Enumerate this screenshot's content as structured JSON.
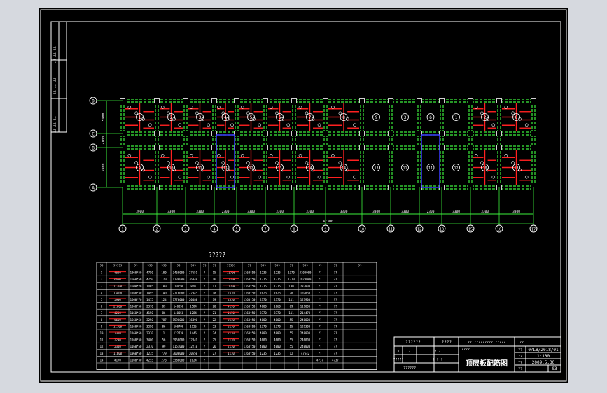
{
  "drawing": {
    "title": "顶层板配筋图",
    "table_title": "?????"
  },
  "axes": {
    "row_labels": [
      "D",
      "C",
      "B",
      "A"
    ],
    "column_labels": [
      "1",
      "2",
      "3",
      "4",
      "5",
      "7",
      "8",
      "9",
      "10",
      "11",
      "12",
      "13",
      "15",
      "16",
      "17"
    ],
    "bay_dims": [
      "3900",
      "3300",
      "3300",
      "2300",
      "3300",
      "3300",
      "3300",
      "3300",
      "3300",
      "3300",
      "2300",
      "3300",
      "3300",
      "3300"
    ],
    "overall_dim": "47300",
    "row_dims": [
      "5900",
      "2100",
      "5900"
    ]
  },
  "left_strip": {
    "cells": [
      "?? ?? ??",
      "?? ?? ??",
      "?? ?? ??"
    ]
  },
  "table": {
    "header": [
      "??",
      "?????",
      "??",
      "???",
      "???",
      "??",
      "???",
      "??"
    ],
    "rows": [
      [
        "1",
        "4050",
        "1060*50",
        "4750",
        "100",
        "3460000",
        "27651",
        "?"
      ],
      [
        "2",
        "6600",
        "1660*50",
        "4750",
        "120",
        "1130000",
        "36840",
        "?"
      ],
      [
        "3",
        "11700",
        "1600*70",
        "1465",
        "100",
        "10950",
        "870",
        "?"
      ],
      [
        "4",
        "13400",
        "1160*50",
        "1495",
        "140",
        "2710000",
        "22345",
        "?"
      ],
      [
        "5",
        "5900",
        "1660*70",
        "1475",
        "124",
        "1770000",
        "20480",
        "?"
      ],
      [
        "6",
        "21000",
        "1060*50",
        "2370",
        "89",
        "140050",
        "1584",
        "?"
      ],
      [
        "7",
        "4200",
        "1160*50",
        "4150",
        "86",
        "140050",
        "1284",
        "?"
      ],
      [
        "8",
        "5600",
        "1660*50",
        "3250",
        "787",
        "1590000",
        "16490",
        "?"
      ],
      [
        "9",
        "11700",
        "1160*50",
        "3250",
        "86",
        "100790",
        "1126",
        "?"
      ],
      [
        "10",
        "2310",
        "1160*50",
        "2370",
        "1",
        "122730",
        "1446",
        "?"
      ],
      [
        "11",
        "2240",
        "1160*50",
        "3400",
        "56",
        "3950000",
        "12849",
        "?"
      ],
      [
        "12",
        "2340",
        "1160*50",
        "2370",
        "99",
        "1151000",
        "12210",
        "?"
      ],
      [
        "13",
        "11600",
        "1060*50",
        "1235",
        "779",
        "3600000",
        "20550",
        "?"
      ],
      [
        "14",
        "4170",
        "1160*50",
        "4255",
        "276",
        "3580000",
        "1024",
        "?"
      ]
    ],
    "rows_right": [
      [
        "15",
        "11700",
        "1160*50",
        "1235",
        "1235",
        "1370",
        "3100000",
        "??"
      ],
      [
        "16",
        "11700",
        "1160*50",
        "1375",
        "1375",
        "1370",
        "1970000",
        "??"
      ],
      [
        "17",
        "11700",
        "1160*50",
        "1375",
        "1375",
        "130",
        "233000",
        "??"
      ],
      [
        "18",
        "2510",
        "1160*50",
        "1025",
        "1025",
        "70",
        "107030",
        "??"
      ],
      [
        "19",
        "2370",
        "1160*50",
        "2370",
        "2370",
        "111",
        "127900",
        "??"
      ],
      [
        "20",
        "4170",
        "1160*50",
        "4000",
        "1060",
        "69",
        "111000",
        "??"
      ],
      [
        "21",
        "1170",
        "1160*50",
        "2370",
        "2370",
        "111",
        "214470",
        "??"
      ],
      [
        "22",
        "2170",
        "1160*50",
        "4000",
        "4000",
        "55",
        "240000",
        "??"
      ],
      [
        "23",
        "2170",
        "1160*50",
        "1370",
        "1370",
        "55",
        "121300",
        "??"
      ],
      [
        "24",
        "2170",
        "1160*50",
        "4000",
        "4000",
        "55",
        "240000",
        "??"
      ],
      [
        "25",
        "2170",
        "1160*50",
        "4000",
        "4000",
        "55",
        "240000",
        "??"
      ],
      [
        "26",
        "2170",
        "1160*50",
        "4000",
        "4000",
        "55",
        "240000",
        "??"
      ],
      [
        "27",
        "1170",
        "1160*50",
        "1235",
        "1235",
        "12",
        "47542",
        "??"
      ],
      [
        "",
        "",
        "",
        "",
        "",
        "",
        "",
        "4737"
      ]
    ]
  },
  "title_block": {
    "project_name": "?? ????????? ?????",
    "sheet_title": "顶层板配筋图",
    "row1_left": "??????",
    "row1_mid": "????",
    "row2_a": "1",
    "row2_b": "?",
    "row2_c": "? ?",
    "row3_a": "?????",
    "row3_c": "? ? ?",
    "labels_right": [
      "??",
      "??",
      "??",
      "??"
    ],
    "values_right": [
      "0/LB/2018/01",
      "1:100",
      "2009.5.30",
      "03"
    ],
    "label_mid_small": "????",
    "col_label": "??",
    "bottom_label": "??????"
  }
}
